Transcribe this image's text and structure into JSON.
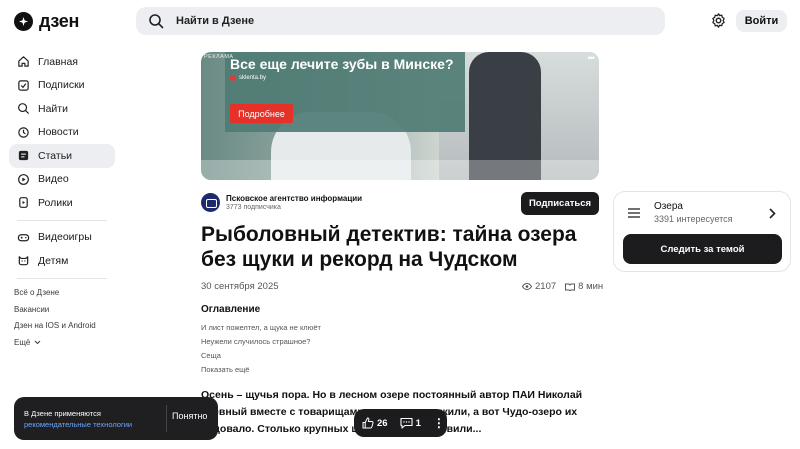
{
  "header": {
    "logo_text": "дзен",
    "search_placeholder": "Найти в Дзене",
    "login_label": "Войти"
  },
  "sidebar": {
    "items": [
      {
        "label": "Главная",
        "icon": "home-icon"
      },
      {
        "label": "Подписки",
        "icon": "subscriptions-icon"
      },
      {
        "label": "Найти",
        "icon": "search-icon"
      },
      {
        "label": "Новости",
        "icon": "news-icon"
      },
      {
        "label": "Статьи",
        "icon": "articles-icon",
        "active": true
      },
      {
        "label": "Видео",
        "icon": "video-icon"
      },
      {
        "label": "Ролики",
        "icon": "shorts-icon"
      }
    ],
    "secondary": [
      {
        "label": "Видеоигры",
        "icon": "gamepad-icon"
      },
      {
        "label": "Детям",
        "icon": "kids-icon"
      }
    ],
    "links": [
      "Всё о Дзене",
      "Вакансии",
      "Дзен на IOS и Android",
      "Ещё"
    ]
  },
  "ad": {
    "badge": "РЕКЛАМА",
    "title": "Все еще лечите зубы в Минске?",
    "source": "sklenta.by",
    "cta": "Подробнее"
  },
  "publisher": {
    "name": "Псковское агентство информации",
    "subscribers": "3773 подписчика",
    "subscribe_label": "Подписаться"
  },
  "article": {
    "title": "Рыболовный детектив: тайна озера без щуки и рекорд на Чудском",
    "date": "30 сентября 2025",
    "views": "2107",
    "read_time": "8 мин",
    "toc_heading": "Оглавление",
    "toc": [
      "И лист пожелтел, а щука не клюёт",
      "Неужели случилось страшное?",
      "Сеща",
      "Показать ещё"
    ],
    "body_lines": [
      "Осень – щучья пора. Но в лесном озере постоянный автор ПАИ Николай",
      "клёвный вместе с товарищами                    аружили, а вот Чудо-озеро их",
      "радовало. Столько крупных щ                    не ловили..."
    ]
  },
  "topic": {
    "name": "Озера",
    "count": "3391 интересуется",
    "follow_label": "Следить за темой"
  },
  "cookie": {
    "line1": "В Дзене применяются",
    "link": "рекомендательные технологии",
    "button": "Понятно"
  },
  "actions": {
    "likes": "26",
    "comments": "1"
  },
  "colors": {
    "accent_dark": "#1c1c1e",
    "ad_button": "#e53128",
    "link": "#6aa6ff"
  }
}
